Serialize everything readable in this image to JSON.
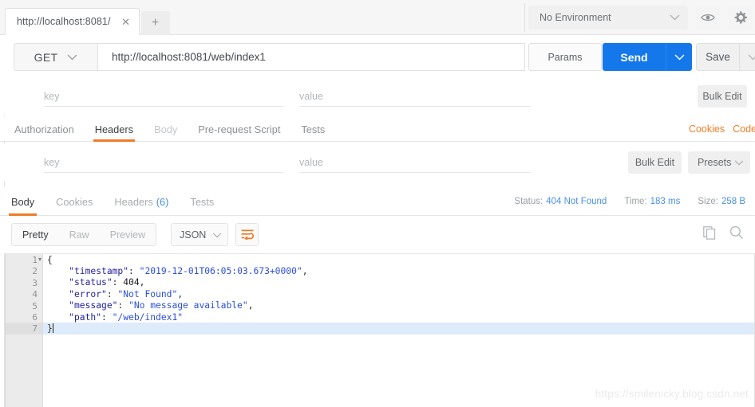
{
  "topbar": {
    "tabs": [
      {
        "label": "http://localhost:8081/",
        "close": "✕"
      }
    ],
    "new_tab": "+",
    "environment": {
      "value": "No Environment",
      "caret": "∨"
    },
    "eye_icon": "eye-icon",
    "gear_icon": "gear-icon"
  },
  "request": {
    "method": "GET",
    "method_caret": "∨",
    "url": "http://localhost:8081/web/index1",
    "params_label": "Params",
    "send_label": "Send",
    "send_caret": "∨",
    "save_label": "Save",
    "save_caret": "∨"
  },
  "params_row": {
    "key_placeholder": "key",
    "value_placeholder": "value",
    "bulk_edit": "Bulk Edit"
  },
  "request_tabs": {
    "items": [
      {
        "label": "Authorization",
        "state": "normal"
      },
      {
        "label": "Headers",
        "state": "active"
      },
      {
        "label": "Body",
        "state": "dim"
      },
      {
        "label": "Pre-request Script",
        "state": "normal"
      },
      {
        "label": "Tests",
        "state": "normal"
      }
    ],
    "links": [
      "Cookies",
      "Code"
    ]
  },
  "headers_row": {
    "key_placeholder": "key",
    "value_placeholder": "value",
    "bulk_edit": "Bulk Edit",
    "presets": "Presets",
    "presets_caret": "∨"
  },
  "response": {
    "tabs": [
      {
        "label": "Body",
        "state": "active",
        "count": ""
      },
      {
        "label": "Cookies",
        "state": "normal",
        "count": ""
      },
      {
        "label": "Headers",
        "state": "normal",
        "count": "(6)"
      },
      {
        "label": "Tests",
        "state": "normal",
        "count": ""
      }
    ],
    "status_label": "Status:",
    "status_value": "404 Not Found",
    "time_label": "Time:",
    "time_value": "183 ms",
    "size_label": "Size:",
    "size_value": "258 B"
  },
  "body_toolbar": {
    "segments": [
      {
        "label": "Pretty",
        "state": "active"
      },
      {
        "label": "Raw",
        "state": "normal"
      },
      {
        "label": "Preview",
        "state": "normal"
      }
    ],
    "format": "JSON",
    "format_caret": "∨",
    "wrap_icon": "word-wrap-icon",
    "copy_icon": "copy-icon",
    "search_icon": "search-icon"
  },
  "code": {
    "lines": [
      {
        "num": "1",
        "fold": "▾",
        "highlight": false,
        "tokens": [
          {
            "t": "{",
            "c": "p"
          }
        ]
      },
      {
        "num": "2",
        "fold": "",
        "highlight": false,
        "tokens": [
          {
            "t": "    \"timestamp\"",
            "c": "k"
          },
          {
            "t": ": ",
            "c": "p"
          },
          {
            "t": "\"2019-12-01T06:05:03.673+0000\"",
            "c": "s"
          },
          {
            "t": ",",
            "c": "p"
          }
        ]
      },
      {
        "num": "3",
        "fold": "",
        "highlight": false,
        "tokens": [
          {
            "t": "    \"status\"",
            "c": "k"
          },
          {
            "t": ": ",
            "c": "p"
          },
          {
            "t": "404",
            "c": "n"
          },
          {
            "t": ",",
            "c": "p"
          }
        ]
      },
      {
        "num": "4",
        "fold": "",
        "highlight": false,
        "tokens": [
          {
            "t": "    \"error\"",
            "c": "k"
          },
          {
            "t": ": ",
            "c": "p"
          },
          {
            "t": "\"Not Found\"",
            "c": "s"
          },
          {
            "t": ",",
            "c": "p"
          }
        ]
      },
      {
        "num": "5",
        "fold": "",
        "highlight": false,
        "tokens": [
          {
            "t": "    \"message\"",
            "c": "k"
          },
          {
            "t": ": ",
            "c": "p"
          },
          {
            "t": "\"No message available\"",
            "c": "s"
          },
          {
            "t": ",",
            "c": "p"
          }
        ]
      },
      {
        "num": "6",
        "fold": "",
        "highlight": false,
        "tokens": [
          {
            "t": "    \"path\"",
            "c": "k"
          },
          {
            "t": ": ",
            "c": "p"
          },
          {
            "t": "\"/web/index1\"",
            "c": "s"
          }
        ]
      },
      {
        "num": "7",
        "fold": "",
        "highlight": true,
        "caret": true,
        "tokens": [
          {
            "t": "}",
            "c": "p"
          }
        ]
      }
    ]
  },
  "watermark": "https://smilenicky.blog.csdn.net",
  "colors": {
    "accent_orange": "#ef7c27",
    "send_blue": "#1478ea",
    "link_blue": "#4a90e2",
    "json_key": "#1e1e9c",
    "json_string": "#2b4fd8",
    "highlight_row": "#ddebfb"
  }
}
